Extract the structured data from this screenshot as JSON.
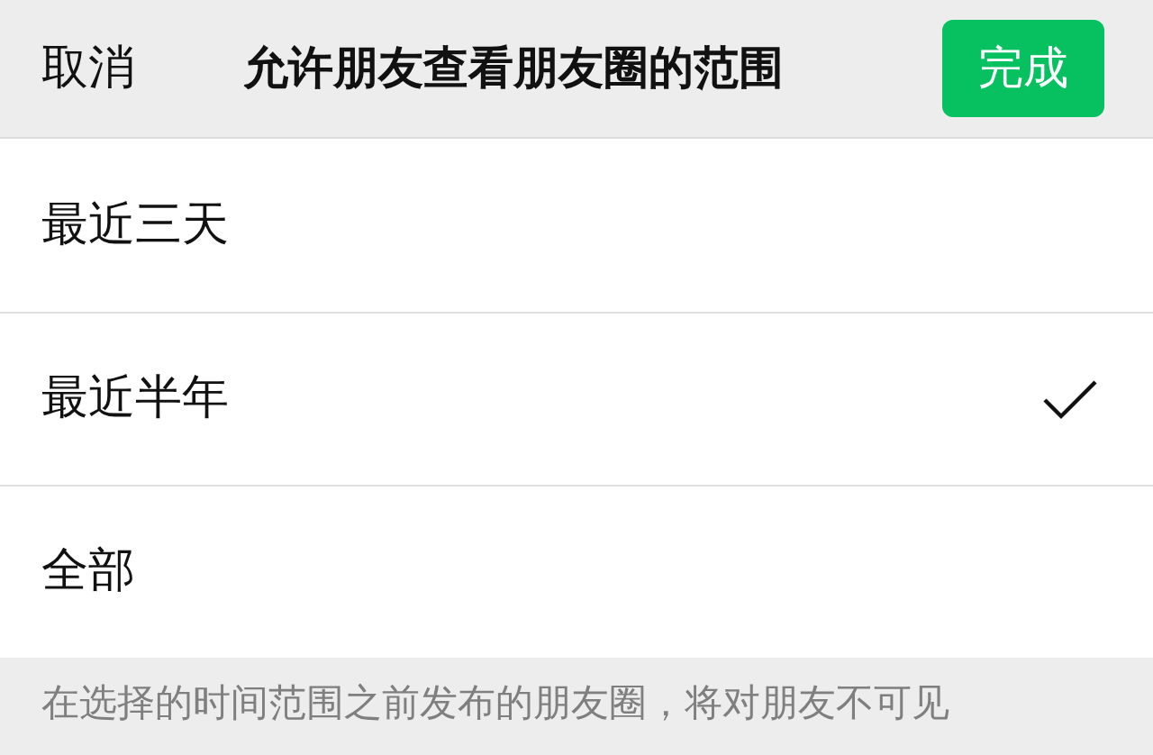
{
  "header": {
    "cancel": "取消",
    "title": "允许朋友查看朋友圈的范围",
    "done": "完成"
  },
  "options": [
    {
      "label": "最近三天",
      "selected": false
    },
    {
      "label": "最近半年",
      "selected": true
    },
    {
      "label": "全部",
      "selected": false
    }
  ],
  "footnote": "在选择的时间范围之前发布的朋友圈，将对朋友不可见"
}
